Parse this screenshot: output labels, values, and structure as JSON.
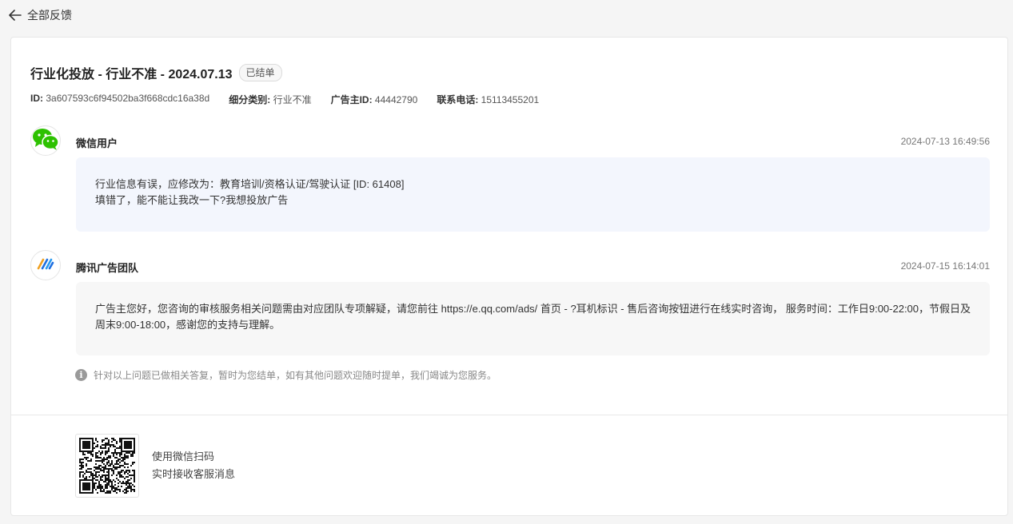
{
  "nav": {
    "back_label": "全部反馈"
  },
  "ticket": {
    "title": "行业化投放 - 行业不准 - 2024.07.13",
    "status": "已结单",
    "meta": [
      {
        "key": "ID:",
        "value": "3a607593c6f94502ba3f668cdc16a38d"
      },
      {
        "key": "细分类别:",
        "value": "行业不准"
      },
      {
        "key": "广告主ID:",
        "value": "44442790"
      },
      {
        "key": "联系电话:",
        "value": "15113455201"
      }
    ]
  },
  "messages": [
    {
      "sender": "微信用户",
      "time": "2024-07-13 16:49:56",
      "avatar_icon": "wechat-icon",
      "lines": [
        "行业信息有误，应修改为：教育培训/资格认证/驾驶认证 [ID: 61408]",
        "填错了，能不能让我改一下?我想投放广告"
      ]
    },
    {
      "sender": "腾讯广告团队",
      "time": "2024-07-15 16:14:01",
      "avatar_icon": "tencent-ads-logo-icon",
      "lines": [
        "广告主您好，您咨询的审核服务相关问题需由对应团队专项解疑，请您前往 https://e.qq.com/ads/ 首页 - ?耳机标识 - 售后咨询按钮进行在线实时咨询， 服务时间：工作日9:00-22:00，节假日及周末9:00-18:00，感谢您的支持与理解。"
      ]
    }
  ],
  "notice": "针对以上问题已做相关答复，暂时为您结单，如有其他问题欢迎随时提单，我们竭诚为您服务。",
  "qr": {
    "line1": "使用微信扫码",
    "line2": "实时接收客服消息"
  },
  "colors": {
    "wechat_green": "#2dc100",
    "user_bubble": "#f3f6fd",
    "team_bubble": "#f7f7f7"
  }
}
